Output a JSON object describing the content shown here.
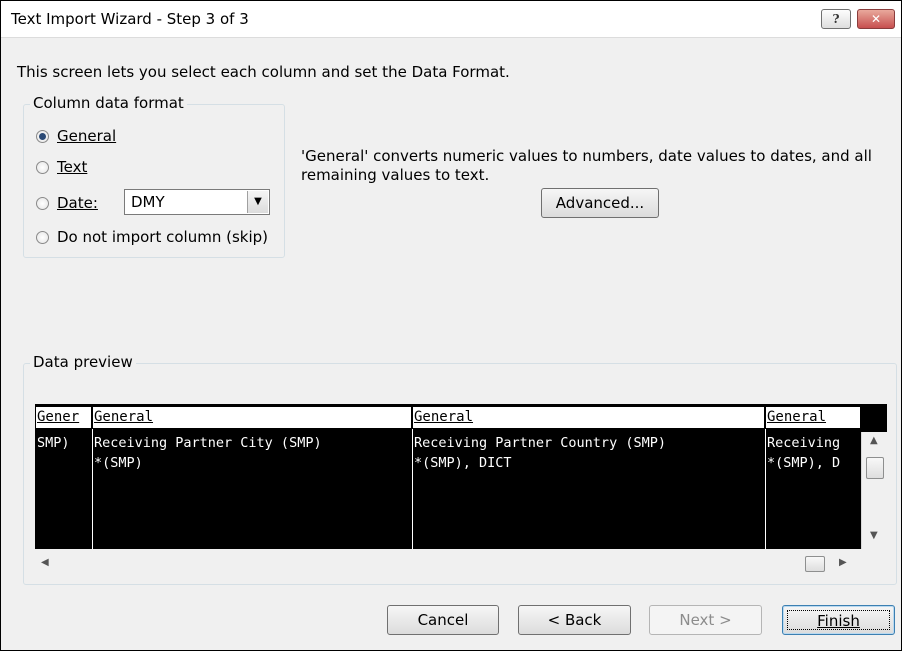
{
  "window": {
    "title": "Text Import Wizard - Step 3 of 3",
    "help_glyph": "?",
    "close_glyph": "✕"
  },
  "intro": "This screen lets you select each column and set the Data Format.",
  "column_format": {
    "group_label": "Column data format",
    "options": [
      {
        "label": "General",
        "selected": true
      },
      {
        "label": "Text",
        "selected": false
      },
      {
        "label": "Date:",
        "selected": false
      },
      {
        "label": "Do not import column (skip)",
        "selected": false
      }
    ],
    "date_format": {
      "value": "DMY",
      "arrow": "▼"
    }
  },
  "description": "'General' converts numeric values to numbers, date values to dates, and all remaining values to text.",
  "advanced_label": "Advanced...",
  "preview": {
    "group_label": "Data preview",
    "headers": [
      "Gener",
      "General",
      "General",
      "General"
    ],
    "rows": [
      [
        "SMP)",
        "Receiving Partner City (SMP)",
        "Receiving Partner Country (SMP)",
        "Receiving"
      ],
      [
        "",
        "*(SMP)",
        "*(SMP), DICT",
        "*(SMP), D"
      ]
    ]
  },
  "scrollbars": {
    "up": "▲",
    "down": "▼",
    "left": "◀",
    "right": "▶"
  },
  "buttons": {
    "cancel": "Cancel",
    "back": "< Back",
    "next": "Next >",
    "finish": "Finish"
  }
}
